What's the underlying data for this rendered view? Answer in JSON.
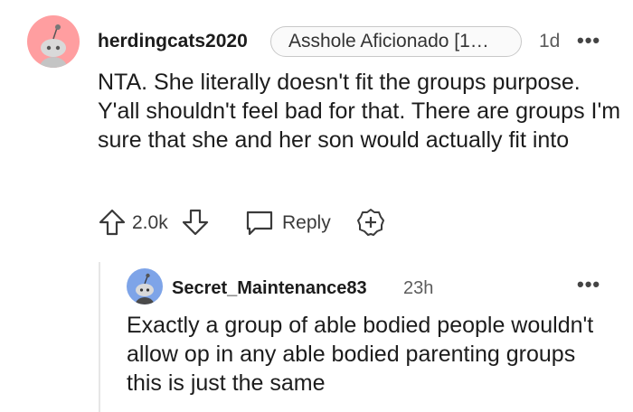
{
  "comment": {
    "username": "herdingcats2020",
    "flair": "Asshole Aficionado [1…",
    "age": "1d",
    "more_label": "•••",
    "body": "NTA. She literally doesn't fit the groups purpose. Y'all shouldn't feel bad for that. There are groups I'm sure that she and her son would actually fit into",
    "score": "2.0k",
    "reply_label": "Reply",
    "icons": [
      "snoo-avatar",
      "upvote-icon",
      "downvote-icon",
      "reply-icon",
      "award-icon",
      "more-icon"
    ]
  },
  "reply": {
    "username": "Secret_Maintenance83",
    "age": "23h",
    "more_label": "•••",
    "body": "Exactly a group of able bodied people wouldn't allow op in any able bodied parenting groups this is just the same"
  },
  "colors": {
    "avatar_bg_1": "#ff9ea0",
    "avatar_bg_2": "#7ea4e8",
    "meta_text": "#5c5c5c",
    "thread_line": "#e6e6e6"
  }
}
